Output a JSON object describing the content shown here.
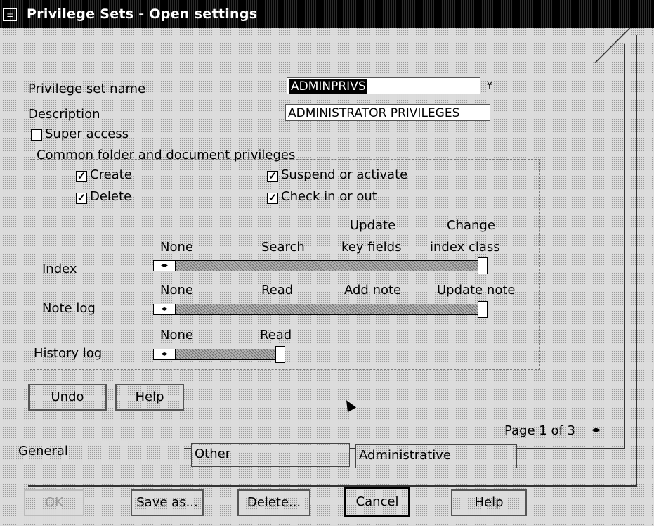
{
  "window": {
    "title": "Privilege Sets - Open settings",
    "sysmenu_glyph": "≡"
  },
  "form": {
    "name_label": "Privilege set name",
    "name_value": "ADMINPRIVS",
    "dropdown_glyph": "¥",
    "desc_label": "Description",
    "desc_value": "ADMINISTRATOR PRIVILEGES",
    "super_access": {
      "label": "Super access",
      "checked": false
    },
    "group_label": "Common folder and document privileges",
    "checkboxes": [
      {
        "label": "Create",
        "checked": true
      },
      {
        "label": "Delete",
        "checked": true
      },
      {
        "label": "Suspend or activate",
        "checked": true
      },
      {
        "label": "Check in or out",
        "checked": true
      }
    ],
    "check_mark": "✓",
    "index": {
      "label": "Index",
      "stops": [
        "None",
        "Search",
        "Update\nkey fields",
        "Change\nindex class"
      ],
      "stop_line1": [
        "",
        "",
        "Update",
        "Change"
      ],
      "stop_line2": [
        "None",
        "Search",
        "key fields",
        "index class"
      ],
      "level_fraction": 1.0
    },
    "note_log": {
      "label": "Note log",
      "stops": [
        "None",
        "Read",
        "Add note",
        "Update note"
      ],
      "level_fraction": 1.0
    },
    "history_log": {
      "label": "History log",
      "stops": [
        "None",
        "Read"
      ],
      "level_fraction": 1.0
    },
    "slider_arrows": "◂▸"
  },
  "page_buttons": {
    "undo": "Undo",
    "help": "Help"
  },
  "pager": {
    "text": "Page 1 of 3",
    "arrows": "◂▸"
  },
  "tabs": [
    "General",
    "Other",
    "Administrative"
  ],
  "footer": {
    "ok": "OK",
    "save_as": "Save as...",
    "delete": "Delete...",
    "cancel": "Cancel",
    "help": "Help"
  }
}
